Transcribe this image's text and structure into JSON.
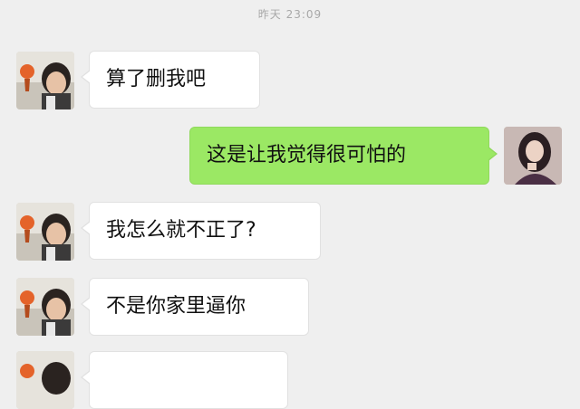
{
  "chat": {
    "timestamp": "昨天 23:09",
    "messages": [
      {
        "side": "left",
        "text": "算了删我吧",
        "avatar": "boy-avatar"
      },
      {
        "side": "right",
        "text": "这是让我觉得很可怕的",
        "avatar": "girl-avatar"
      },
      {
        "side": "left",
        "text": "我怎么就不正了?",
        "avatar": "boy-avatar"
      },
      {
        "side": "left",
        "text": "不是你家里逼你",
        "avatar": "boy-avatar"
      },
      {
        "side": "left",
        "text": "",
        "avatar": "boy-avatar"
      }
    ]
  },
  "colors": {
    "background": "#efefef",
    "incoming_bubble": "#ffffff",
    "outgoing_bubble": "#9be864",
    "timestamp_text": "#a8a8a8"
  }
}
